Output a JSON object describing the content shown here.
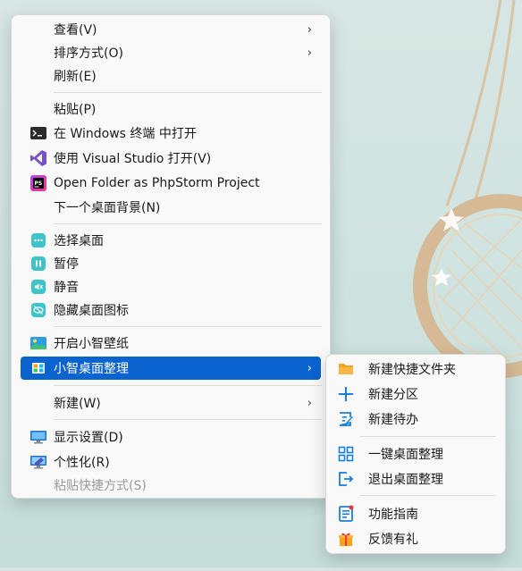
{
  "main_menu": {
    "items": [
      {
        "label": "查看(V)"
      },
      {
        "label": "排序方式(O)"
      },
      {
        "label": "刷新(E)"
      },
      {
        "label": "粘贴(P)"
      },
      {
        "label": "在 Windows 终端 中打开"
      },
      {
        "label": "使用 Visual Studio 打开(V)"
      },
      {
        "label": "Open Folder as PhpStorm Project"
      },
      {
        "label": "下一个桌面背景(N)"
      },
      {
        "label": "选择桌面"
      },
      {
        "label": "暂停"
      },
      {
        "label": "静音"
      },
      {
        "label": "隐藏桌面图标"
      },
      {
        "label": "开启小智壁纸"
      },
      {
        "label": "小智桌面整理"
      },
      {
        "label": "新建(W)"
      },
      {
        "label": "显示设置(D)"
      },
      {
        "label": "个性化(R)"
      },
      {
        "label": "粘贴快捷方式(S)"
      }
    ],
    "chevron": "›"
  },
  "sub_menu": {
    "items": [
      {
        "label": "新建快捷文件夹"
      },
      {
        "label": "新建分区"
      },
      {
        "label": "新建待办"
      },
      {
        "label": "一键桌面整理"
      },
      {
        "label": "退出桌面整理"
      },
      {
        "label": "功能指南"
      },
      {
        "label": "反馈有礼"
      }
    ]
  },
  "colors": {
    "highlight": "#0a63cf",
    "accent_orange": "#f7a21b",
    "accent_blue": "#1a7fd6"
  }
}
